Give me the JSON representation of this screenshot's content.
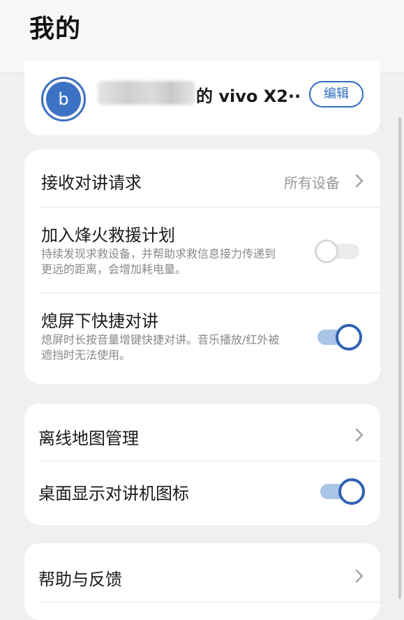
{
  "header": {
    "title": "我的"
  },
  "profile": {
    "avatar_letter": "b",
    "device_name": "的 vivo X2··",
    "edit_label": "编辑"
  },
  "settings": {
    "receive_talk": {
      "title": "接收对讲请求",
      "value": "所有设备"
    },
    "beacon_rescue": {
      "title": "加入烽火救援计划",
      "description": "持续发现求救设备，并帮助求救信息接力传递到更远的距离，会增加耗电量。",
      "enabled": false
    },
    "screen_off_talk": {
      "title": "熄屏下快捷对讲",
      "description": "熄屏时长按音量增键快捷对讲。音乐播放/红外被遮挡时无法使用。",
      "enabled": true
    }
  },
  "map_settings": {
    "offline_map": {
      "title": "离线地图管理"
    },
    "desktop_icon": {
      "title": "桌面显示对讲机图标",
      "enabled": true
    }
  },
  "support": {
    "help": {
      "title": "帮助与反馈"
    }
  },
  "colors": {
    "accent": "#2f63b3",
    "toggle_on_track": "#a9c4e6",
    "background": "#f0f0f2"
  }
}
